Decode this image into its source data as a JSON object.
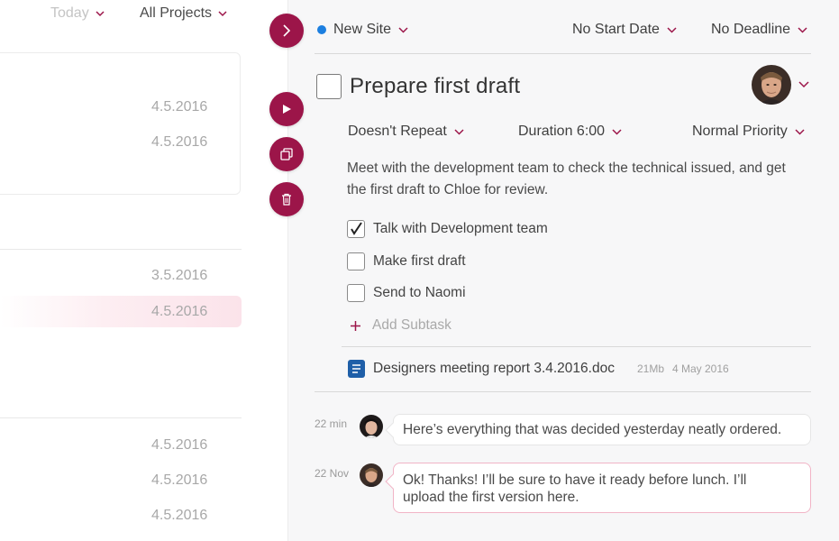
{
  "filters": {
    "when": "Today",
    "project": "All Projects"
  },
  "list": {
    "dates": [
      "4.5.2016",
      "4.5.2016",
      "3.5.2016",
      "4.5.2016",
      "4.5.2016",
      "4.5.2016",
      "4.5.2016"
    ]
  },
  "header": {
    "project": "New Site",
    "project_color": "#1c7fe0",
    "start_date": "No Start Date",
    "deadline": "No Deadline"
  },
  "task": {
    "title": "Prepare first draft",
    "repeat": "Doesn't Repeat",
    "duration": "Duration 6:00",
    "priority": "Normal Priority",
    "description": "Meet with the development team to check the technical issued, and get the first draft to Chloe for review.",
    "subtasks": [
      {
        "label": "Talk with Development team",
        "checked": true
      },
      {
        "label": "Make first draft",
        "checked": false
      },
      {
        "label": "Send to Naomi",
        "checked": false
      }
    ],
    "add_subtask": "Add Subtask",
    "attachment": {
      "name": "Designers meeting report 3.4.2016.doc",
      "size": "21Mb",
      "date": "4 May 2016"
    }
  },
  "comments": [
    {
      "time": "22 min",
      "text": "Here’s everything that was decided yesterday neatly ordered."
    },
    {
      "time": "22 Nov",
      "text_line1": "Ok! Thanks! I’ll be sure to have it ready before lunch. I’ll",
      "text_line2": "upload the first version here."
    }
  ],
  "colors": {
    "accent": "#9c1549",
    "accent_light": "#fbe3ea"
  },
  "icons": {
    "toggle": "chevron-right-icon",
    "play": "play-icon",
    "duplicate": "duplicate-icon",
    "delete": "trash-icon",
    "attachment": "document-icon",
    "add": "plus-icon"
  }
}
